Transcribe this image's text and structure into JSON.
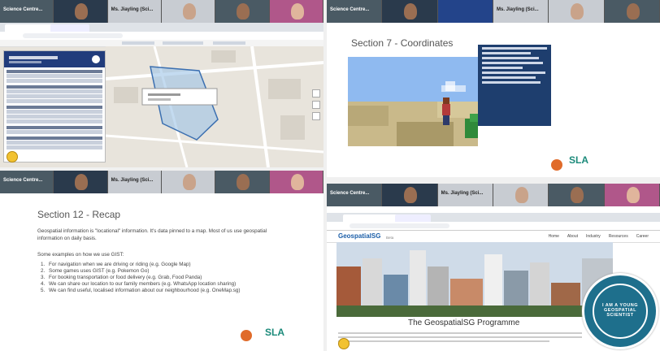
{
  "meeting": {
    "tiles_tl": [
      "Science Centre...",
      "",
      "Ms. Jiayling (Sci...",
      "",
      "",
      ""
    ],
    "tiles_tr": [
      "Science Centre...",
      "",
      "",
      "Ms. Jiayling (Sci...",
      "",
      ""
    ],
    "tiles_bl": [
      "Science Centre...",
      "",
      "Ms. Jiayling (Sci...",
      "",
      "",
      ""
    ],
    "tiles_br": [
      "Science Centre...",
      "",
      "Ms. Jiayling (Sci...",
      "",
      "",
      ""
    ]
  },
  "slide_coordinates": {
    "title": "Section 7 - Coordinates",
    "logo": "SLA"
  },
  "slide_recap": {
    "title": "Section 12 - Recap",
    "intro": "Geospatial information is \"locational\" information. It's data pinned to a map. Most of us use geospatial information on daily basis.",
    "lead": "Some examples on how we use GIST:",
    "items": [
      "For navigation when we are driving or riding (e.g. Google Map)",
      "Some games uses GIST (e.g. Pokemon Go)",
      "For booking transportation or food delivery (e.g. Grab, Food Panda)",
      "We can share our location to our family members (e.g. WhatsApp location sharing)",
      "We can find useful, localised information about our neighbourhood (e.g. OneMap.sg)"
    ],
    "logo": "SLA"
  },
  "geo_site": {
    "brand": "GeospatialSG",
    "brand_sub": "Beta",
    "nav": [
      "Home",
      "About",
      "Industry",
      "Resources",
      "Career"
    ],
    "heading": "The GeospatialSG Programme"
  },
  "badge": {
    "text": "I AM A YOUNG GEOSPATIAL SCIENTIST"
  },
  "colors": {
    "map_bg": "#e8e4dc",
    "sidebar": "#213c7c",
    "badge": "#1e6f8c"
  }
}
